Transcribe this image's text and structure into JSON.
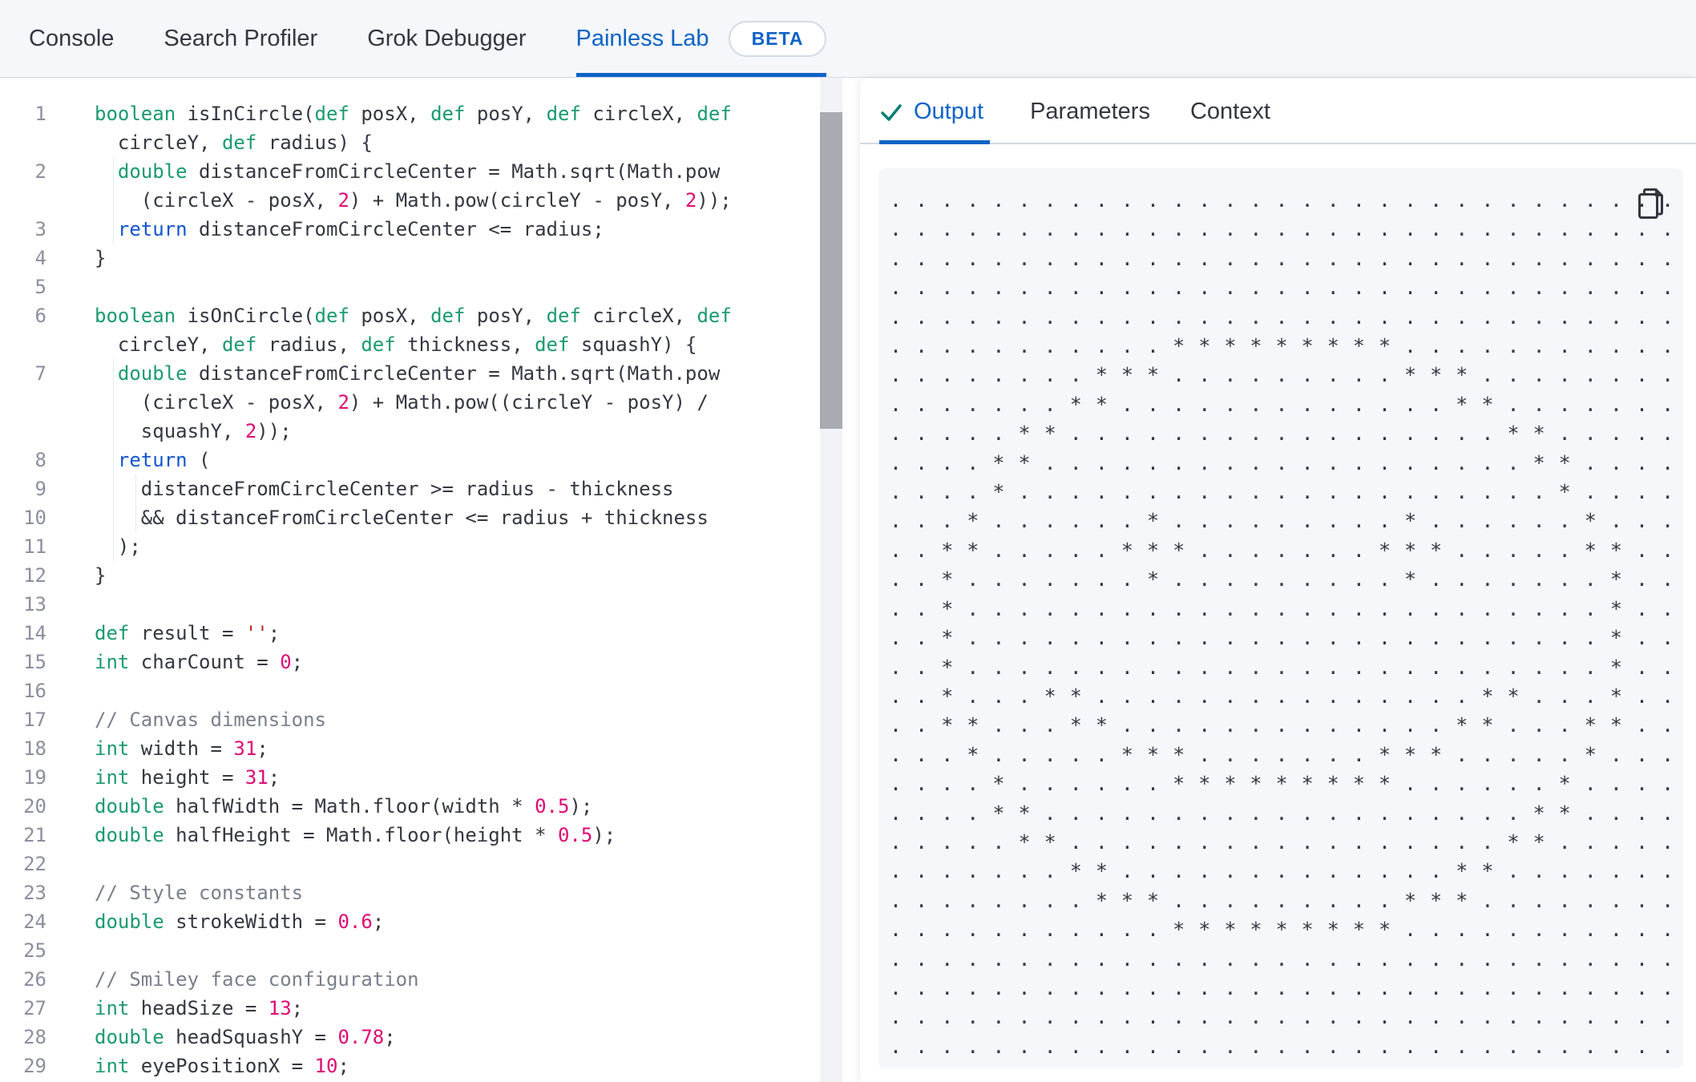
{
  "colors": {
    "primary_blue": "#0e63c6",
    "nav_bg": "#f5f7fa",
    "border_gray": "#d3dae6",
    "text_dark": "#343741",
    "keyword_green": "#1b9a6f",
    "control_blue": "#1155d0",
    "number_pink": "#dd0a73",
    "string_red": "#bd271e",
    "comment_gray": "#7a7f8c",
    "output_bg": "#f5f7fa",
    "check_teal": "#017d73"
  },
  "nav": {
    "tabs": [
      {
        "label": "Console",
        "active": false
      },
      {
        "label": "Search Profiler",
        "active": false
      },
      {
        "label": "Grok Debugger",
        "active": false
      },
      {
        "label": "Painless Lab",
        "active": true,
        "badge": "BETA"
      }
    ]
  },
  "editor": {
    "lines": [
      {
        "n": "1",
        "g": 0,
        "s": [
          [
            "k",
            "boolean"
          ],
          [
            "p",
            " isInCircle("
          ],
          [
            "k",
            "def"
          ],
          [
            "p",
            " posX, "
          ],
          [
            "k",
            "def"
          ],
          [
            "p",
            " posY, "
          ],
          [
            "k",
            "def"
          ],
          [
            "p",
            " circleX, "
          ],
          [
            "k",
            "def"
          ]
        ]
      },
      {
        "n": "",
        "g": 0,
        "s": [
          [
            "p",
            "  circleY, "
          ],
          [
            "k",
            "def"
          ],
          [
            "p",
            " radius) {"
          ]
        ]
      },
      {
        "n": "2",
        "g": 1,
        "s": [
          [
            "p",
            "  "
          ],
          [
            "k",
            "double"
          ],
          [
            "p",
            " distanceFromCircleCenter = Math.sqrt(Math.pow"
          ]
        ]
      },
      {
        "n": "",
        "g": 1,
        "s": [
          [
            "p",
            "    (circleX - posX, "
          ],
          [
            "n",
            "2"
          ],
          [
            "p",
            ") + Math.pow(circleY - posY, "
          ],
          [
            "n",
            "2"
          ],
          [
            "p",
            "));"
          ]
        ]
      },
      {
        "n": "3",
        "g": 1,
        "s": [
          [
            "p",
            "  "
          ],
          [
            "r",
            "return"
          ],
          [
            "p",
            " distanceFromCircleCenter <= radius;"
          ]
        ]
      },
      {
        "n": "4",
        "g": 0,
        "s": [
          [
            "p",
            "}"
          ]
        ]
      },
      {
        "n": "5",
        "g": 0,
        "s": []
      },
      {
        "n": "6",
        "g": 0,
        "s": [
          [
            "k",
            "boolean"
          ],
          [
            "p",
            " isOnCircle("
          ],
          [
            "k",
            "def"
          ],
          [
            "p",
            " posX, "
          ],
          [
            "k",
            "def"
          ],
          [
            "p",
            " posY, "
          ],
          [
            "k",
            "def"
          ],
          [
            "p",
            " circleX, "
          ],
          [
            "k",
            "def"
          ]
        ]
      },
      {
        "n": "",
        "g": 0,
        "s": [
          [
            "p",
            "  circleY, "
          ],
          [
            "k",
            "def"
          ],
          [
            "p",
            " radius, "
          ],
          [
            "k",
            "def"
          ],
          [
            "p",
            " thickness, "
          ],
          [
            "k",
            "def"
          ],
          [
            "p",
            " squashY) {"
          ]
        ]
      },
      {
        "n": "7",
        "g": 1,
        "s": [
          [
            "p",
            "  "
          ],
          [
            "k",
            "double"
          ],
          [
            "p",
            " distanceFromCircleCenter = Math.sqrt(Math.pow"
          ]
        ]
      },
      {
        "n": "",
        "g": 1,
        "s": [
          [
            "p",
            "    (circleX - posX, "
          ],
          [
            "n",
            "2"
          ],
          [
            "p",
            ") + Math.pow((circleY - posY) /"
          ]
        ]
      },
      {
        "n": "",
        "g": 1,
        "s": [
          [
            "p",
            "    squashY, "
          ],
          [
            "n",
            "2"
          ],
          [
            "p",
            "));"
          ]
        ]
      },
      {
        "n": "8",
        "g": 1,
        "s": [
          [
            "p",
            "  "
          ],
          [
            "r",
            "return"
          ],
          [
            "p",
            " ("
          ]
        ]
      },
      {
        "n": "9",
        "g": 2,
        "s": [
          [
            "p",
            "    distanceFromCircleCenter >= radius - thickness"
          ]
        ]
      },
      {
        "n": "10",
        "g": 2,
        "s": [
          [
            "p",
            "    && distanceFromCircleCenter <= radius + thickness"
          ]
        ]
      },
      {
        "n": "11",
        "g": 1,
        "s": [
          [
            "p",
            "  );"
          ]
        ]
      },
      {
        "n": "12",
        "g": 0,
        "s": [
          [
            "p",
            "}"
          ]
        ]
      },
      {
        "n": "13",
        "g": 0,
        "s": []
      },
      {
        "n": "14",
        "g": 0,
        "s": [
          [
            "k",
            "def"
          ],
          [
            "p",
            " result = "
          ],
          [
            "s",
            "''"
          ],
          [
            "p",
            ";"
          ]
        ]
      },
      {
        "n": "15",
        "g": 0,
        "s": [
          [
            "k",
            "int"
          ],
          [
            "p",
            " charCount = "
          ],
          [
            "n",
            "0"
          ],
          [
            "p",
            ";"
          ]
        ]
      },
      {
        "n": "16",
        "g": 0,
        "s": []
      },
      {
        "n": "17",
        "g": 0,
        "s": [
          [
            "c",
            "// Canvas dimensions"
          ]
        ]
      },
      {
        "n": "18",
        "g": 0,
        "s": [
          [
            "k",
            "int"
          ],
          [
            "p",
            " width = "
          ],
          [
            "n",
            "31"
          ],
          [
            "p",
            ";"
          ]
        ]
      },
      {
        "n": "19",
        "g": 0,
        "s": [
          [
            "k",
            "int"
          ],
          [
            "p",
            " height = "
          ],
          [
            "n",
            "31"
          ],
          [
            "p",
            ";"
          ]
        ]
      },
      {
        "n": "20",
        "g": 0,
        "s": [
          [
            "k",
            "double"
          ],
          [
            "p",
            " halfWidth = Math.floor(width * "
          ],
          [
            "n",
            "0.5"
          ],
          [
            "p",
            ");"
          ]
        ]
      },
      {
        "n": "21",
        "g": 0,
        "s": [
          [
            "k",
            "double"
          ],
          [
            "p",
            " halfHeight = Math.floor(height * "
          ],
          [
            "n",
            "0.5"
          ],
          [
            "p",
            ");"
          ]
        ]
      },
      {
        "n": "22",
        "g": 0,
        "s": []
      },
      {
        "n": "23",
        "g": 0,
        "s": [
          [
            "c",
            "// Style constants"
          ]
        ]
      },
      {
        "n": "24",
        "g": 0,
        "s": [
          [
            "k",
            "double"
          ],
          [
            "p",
            " strokeWidth = "
          ],
          [
            "n",
            "0.6"
          ],
          [
            "p",
            ";"
          ]
        ]
      },
      {
        "n": "25",
        "g": 0,
        "s": []
      },
      {
        "n": "26",
        "g": 0,
        "s": [
          [
            "c",
            "// Smiley face configuration"
          ]
        ]
      },
      {
        "n": "27",
        "g": 0,
        "s": [
          [
            "k",
            "int"
          ],
          [
            "p",
            " headSize = "
          ],
          [
            "n",
            "13"
          ],
          [
            "p",
            ";"
          ]
        ]
      },
      {
        "n": "28",
        "g": 0,
        "s": [
          [
            "k",
            "double"
          ],
          [
            "p",
            " headSquashY = "
          ],
          [
            "n",
            "0.78"
          ],
          [
            "p",
            ";"
          ]
        ]
      },
      {
        "n": "29",
        "g": 0,
        "s": [
          [
            "k",
            "int"
          ],
          [
            "p",
            " eyePositionX = "
          ],
          [
            "n",
            "10"
          ],
          [
            "p",
            ";"
          ]
        ]
      }
    ]
  },
  "output_panel": {
    "tabs": [
      {
        "label": "Output",
        "active": true,
        "icon": "check-icon"
      },
      {
        "label": "Parameters",
        "active": false
      },
      {
        "label": "Context",
        "active": false
      }
    ],
    "copy_icon": "copy-icon",
    "grid_rows": [
      "...............................",
      "...............................",
      "...............................",
      "...............................",
      "...............................",
      "...........*********...........",
      "........***.........***........",
      ".......**.............**.......",
      ".....**.................**.....",
      "....**...................**....",
      "....*.....................*....",
      "...*......*.........*......*...",
      "..**.....***.......***.....**..",
      "..*.......*.........*.......*..",
      "..*.........................*..",
      "..*.........................*..",
      "..*.........................*..",
      "..*...**...............**...*..",
      "..**...**.............**...**..",
      "...*.....***.......***.....*...",
      "....*......*********......*....",
      "....**...................**....",
      ".....**.................**.....",
      ".......**.............**.......",
      "........***.........***........",
      "...........*********...........",
      "...............................",
      "...............................",
      "...............................",
      "..............................."
    ]
  }
}
